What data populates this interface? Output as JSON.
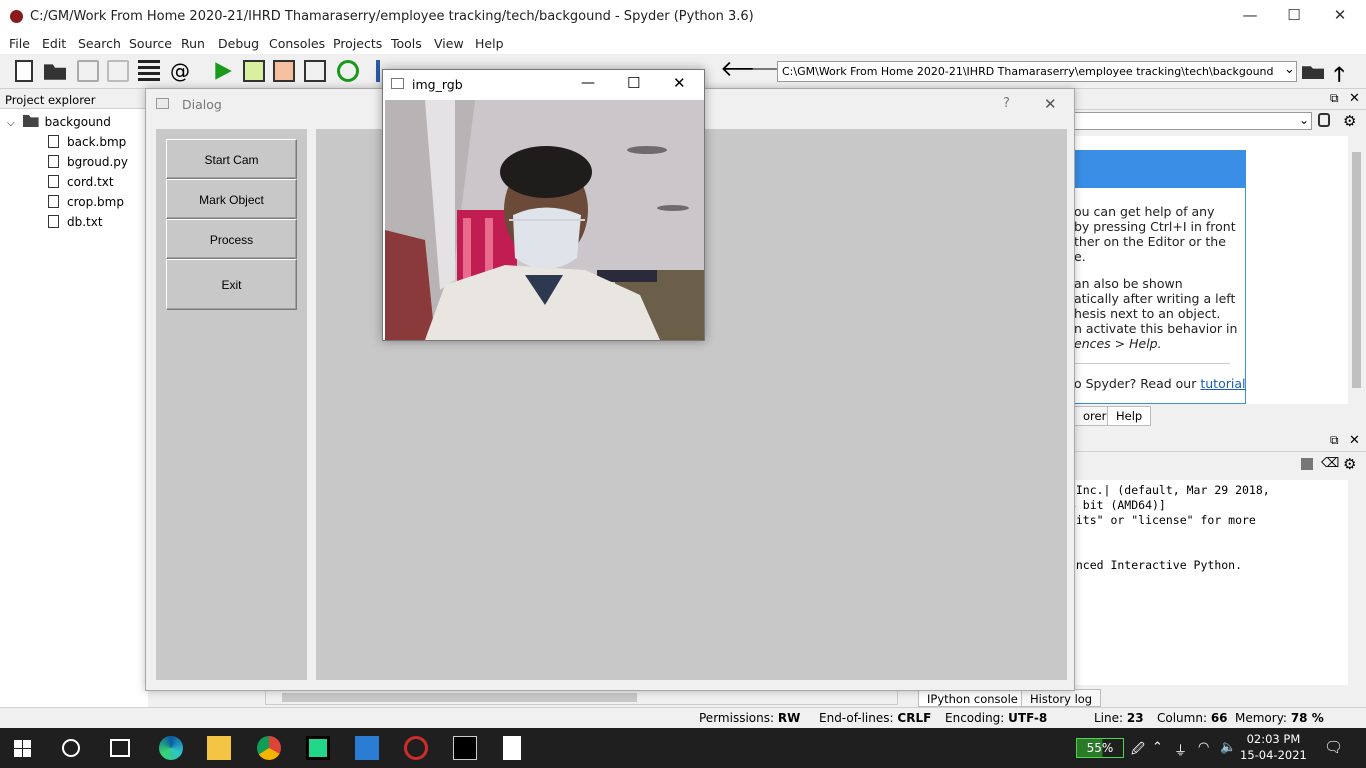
{
  "window": {
    "title": "C:/GM/Work From Home 2020-21/IHRD Thamaraserry/employee tracking/tech/backgound - Spyder (Python 3.6)",
    "minimize": "—",
    "maximize": "☐",
    "close": "✕"
  },
  "menu": [
    "File",
    "Edit",
    "Search",
    "Source",
    "Run",
    "Debug",
    "Consoles",
    "Projects",
    "Tools",
    "View",
    "Help"
  ],
  "toolbar": {
    "path": "C:\\GM\\Work From Home 2020-21\\IHRD Thamaraserry\\employee tracking\\tech\\backgound"
  },
  "project_explorer": {
    "title": "Project explorer",
    "folder": "backgound",
    "files": [
      "back.bmp",
      "bgroud.py",
      "cord.txt",
      "crop.bmp",
      "db.txt"
    ]
  },
  "help_pane": {
    "lines": [
      "ou can get help of any",
      "by pressing Ctrl+I in front",
      "ther on the Editor or the",
      "e.",
      "an also be shown",
      "atically after writing a left",
      "hesis next to an object.",
      "n activate this behavior in",
      "ences > Help.",
      "o Spyder? Read our"
    ],
    "link": "tutorial",
    "tabs": [
      "orer",
      "Help"
    ]
  },
  "console": {
    "lines": [
      ", Inc.| (default, Mar 29 2018,",
      "64 bit (AMD64)]",
      "edits\" or \"license\" for more",
      "",
      "",
      "hanced Interactive Python."
    ],
    "tabs": [
      "IPython console",
      "History log"
    ]
  },
  "status": {
    "permissions_label": "Permissions:",
    "permissions": "RW",
    "eol_label": "End-of-lines:",
    "eol": "CRLF",
    "encoding_label": "Encoding:",
    "encoding": "UTF-8",
    "line_label": "Line:",
    "line": "23",
    "column_label": "Column:",
    "column": "66",
    "memory_label": "Memory:",
    "memory": "78 %"
  },
  "dialog": {
    "title": "Dialog",
    "help": "?",
    "close": "✕",
    "buttons": [
      "Start Cam",
      "Mark Object",
      "Process",
      "Exit"
    ]
  },
  "img_window": {
    "title": "img_rgb",
    "minimize": "—",
    "maximize": "☐",
    "close": "✕"
  },
  "taskbar": {
    "battery": "55%",
    "time": "02:03 PM",
    "date": "15-04-2021"
  },
  "colors": {
    "accent": "#3a8ee6",
    "run_green": "#1a9a1a"
  }
}
